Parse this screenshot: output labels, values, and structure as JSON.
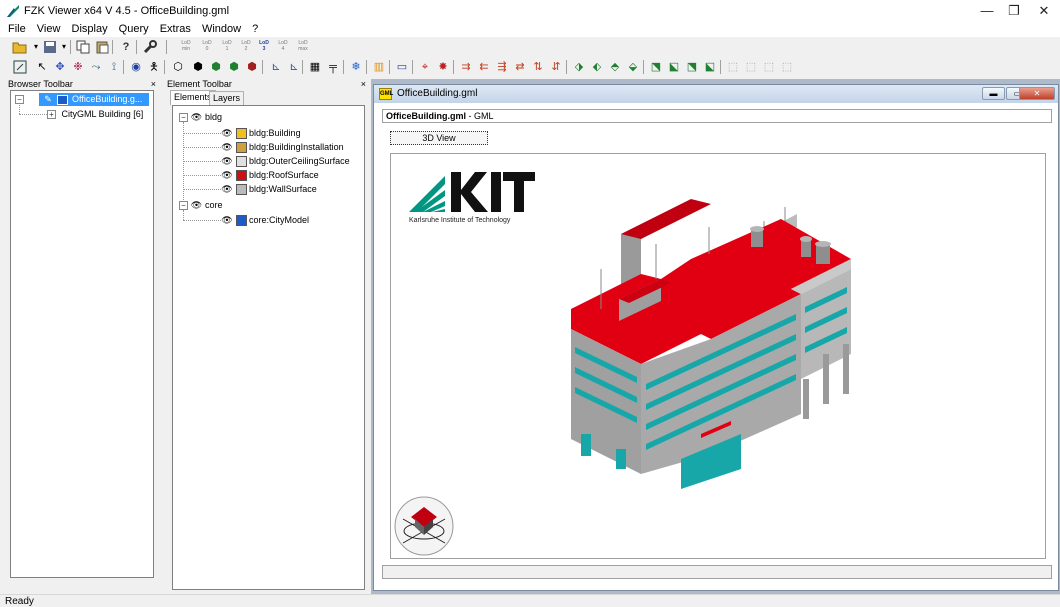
{
  "window": {
    "title": "FZK Viewer x64 V 4.5 - OfficeBuilding.gml",
    "minimize": "—",
    "maximize": "❐",
    "close": "✕"
  },
  "menu": [
    "File",
    "View",
    "Display",
    "Query",
    "Extras",
    "Window",
    "?"
  ],
  "lod_buttons": [
    {
      "top": "LoD",
      "bottom": "min"
    },
    {
      "top": "LoD",
      "bottom": "0"
    },
    {
      "top": "LoD",
      "bottom": "1"
    },
    {
      "top": "LoD",
      "bottom": "2"
    },
    {
      "top": "LoD",
      "bottom": "3"
    },
    {
      "top": "LoD",
      "bottom": "4"
    },
    {
      "top": "LoD",
      "bottom": "max"
    }
  ],
  "browser": {
    "header": "Browser Toolbar",
    "close": "×",
    "root": "OfficeBuilding.g...",
    "child": "CityGML Building [6]"
  },
  "element_panel": {
    "header": "Element Toolbar",
    "close": "×",
    "tabs": [
      "Elements",
      "Layers"
    ],
    "groups": [
      {
        "name": "bldg",
        "items": [
          "bldg:Building",
          "bldg:BuildingInstallation",
          "bldg:OuterCeilingSurface",
          "bldg:RoofSurface",
          "bldg:WallSurface"
        ]
      },
      {
        "name": "core",
        "items": [
          "core:CityModel"
        ]
      }
    ]
  },
  "document": {
    "title": "OfficeBuilding.gml",
    "file_name": "OfficeBuilding.gml",
    "file_type": "- GML",
    "view_tab": "3D View",
    "icon_text": "GML"
  },
  "logo": {
    "name": "KIT",
    "subtitle": "Karlsruhe Institute of Technology"
  },
  "colors": {
    "roof": "#e00012",
    "wall": "#a9a9a9",
    "window": "#17a7a9",
    "kit_green": "#009682",
    "selection": "#3399ff"
  },
  "status": {
    "text": "Ready"
  }
}
